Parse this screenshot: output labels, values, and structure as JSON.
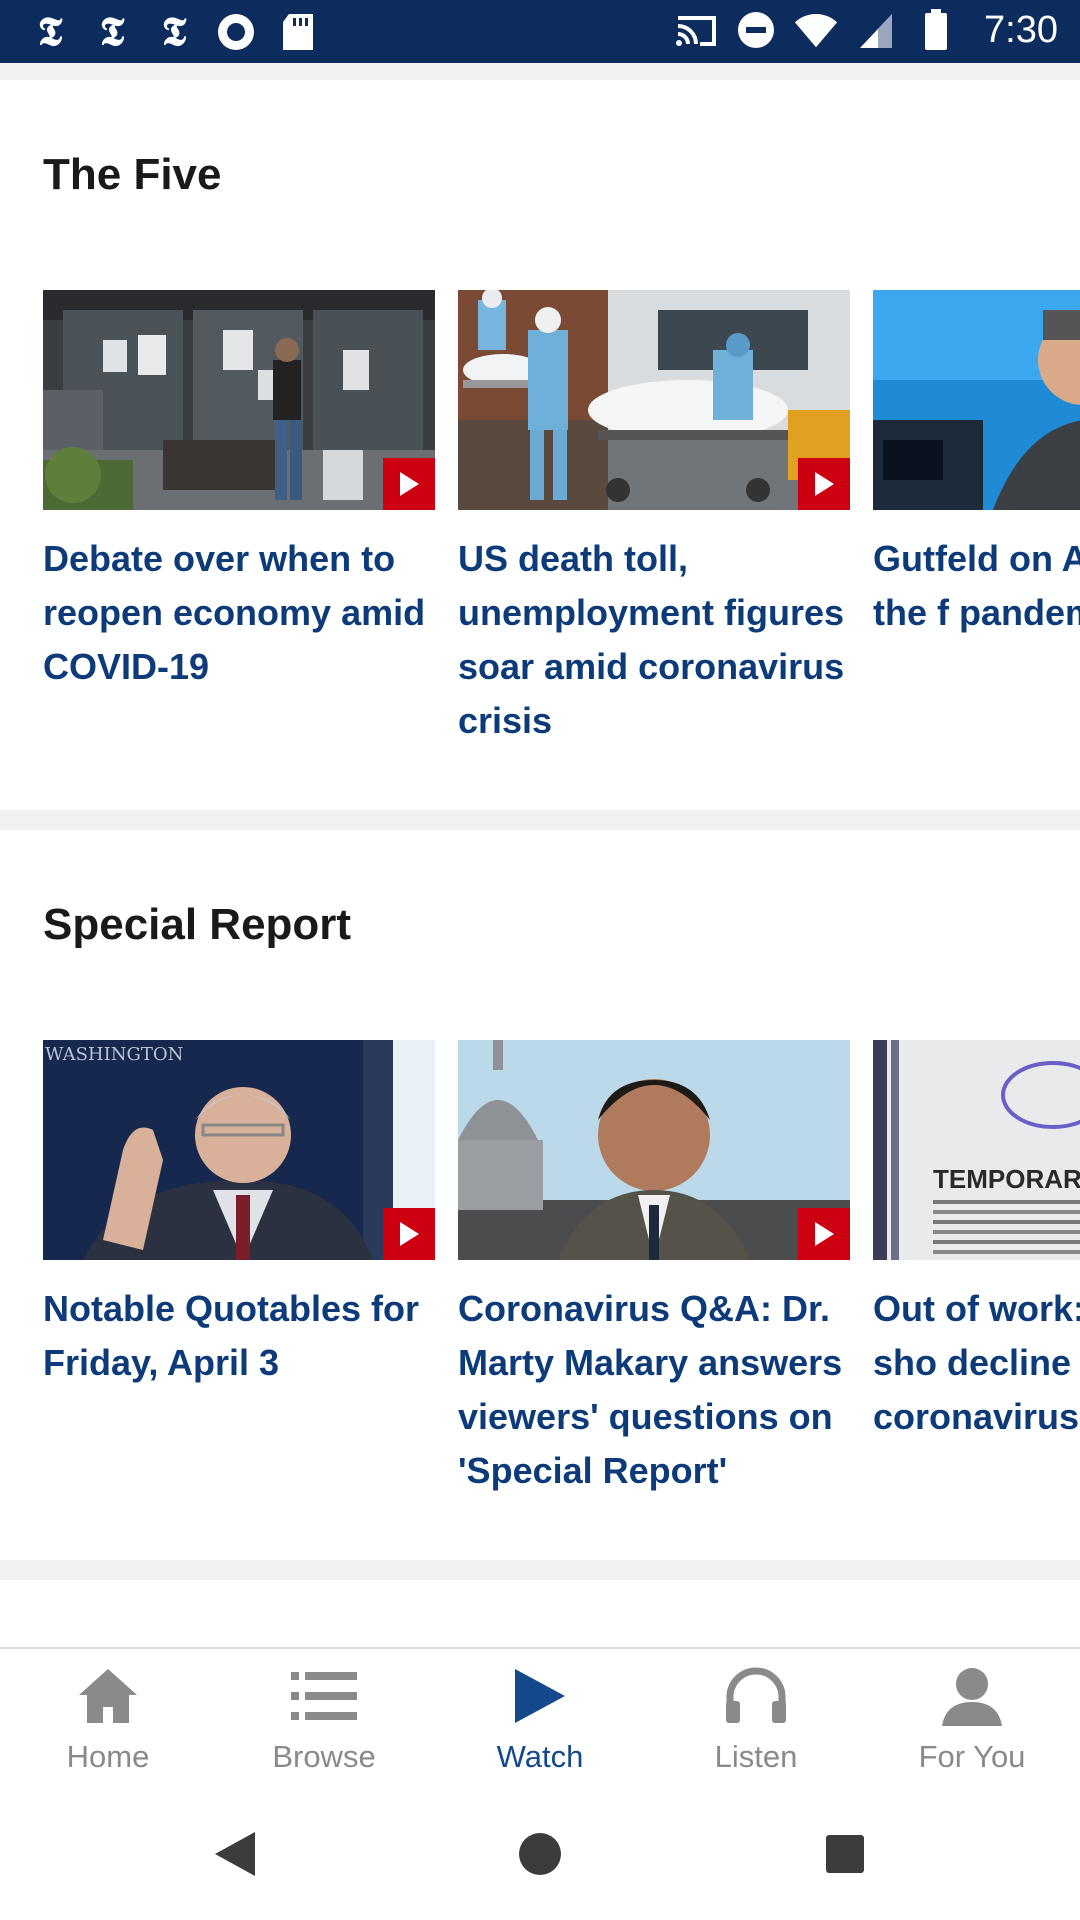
{
  "status_bar": {
    "time": "7:30",
    "left_icons": [
      "nyt-logo-icon",
      "nyt-logo-icon",
      "nyt-logo-icon",
      "circle-record-icon",
      "sd-card-icon"
    ],
    "nyt_glyph": "𝕿",
    "right_icons": [
      "cast-icon",
      "do-not-disturb-icon",
      "wifi-icon",
      "signal-icon",
      "battery-icon"
    ]
  },
  "sections": [
    {
      "title": "The Five",
      "cards": [
        {
          "title": "Debate over when to reopen economy amid COVID-19",
          "thumb": "storefront-photo"
        },
        {
          "title": "US death toll, unemployment figures soar amid coronavirus crisis",
          "thumb": "medical-workers-photo"
        },
        {
          "title": "Gutfeld on A unity in the f pandemic",
          "thumb": "studio-host-photo"
        }
      ]
    },
    {
      "title": "Special Report",
      "cards": [
        {
          "title": "Notable Quotables for Friday, April 3",
          "thumb": "briefing-photo",
          "thumb_text": "WASHINGTON"
        },
        {
          "title": "Coronavirus Q&A: Dr. Marty Makary answers viewers' questions on 'Special Report'",
          "thumb": "capitol-interview-photo"
        },
        {
          "title": "Out of work: numbers sho decline amid coronavirus",
          "thumb": "closed-sign-photo",
          "thumb_text": "TEMPORARI"
        }
      ]
    }
  ],
  "bottom_nav": {
    "active": "Watch",
    "items": [
      {
        "label": "Home",
        "icon": "home-icon"
      },
      {
        "label": "Browse",
        "icon": "list-icon"
      },
      {
        "label": "Watch",
        "icon": "play-icon"
      },
      {
        "label": "Listen",
        "icon": "headphones-icon"
      },
      {
        "label": "For You",
        "icon": "person-icon"
      }
    ]
  },
  "system_nav": [
    "back-icon",
    "home-circle-icon",
    "recents-icon"
  ],
  "colors": {
    "status_bar": "#0d2c5e",
    "headline": "#0d3b7a",
    "active_nav": "#144a8c",
    "play_badge": "#cc0011",
    "section_gap": "#f1f2f4"
  }
}
